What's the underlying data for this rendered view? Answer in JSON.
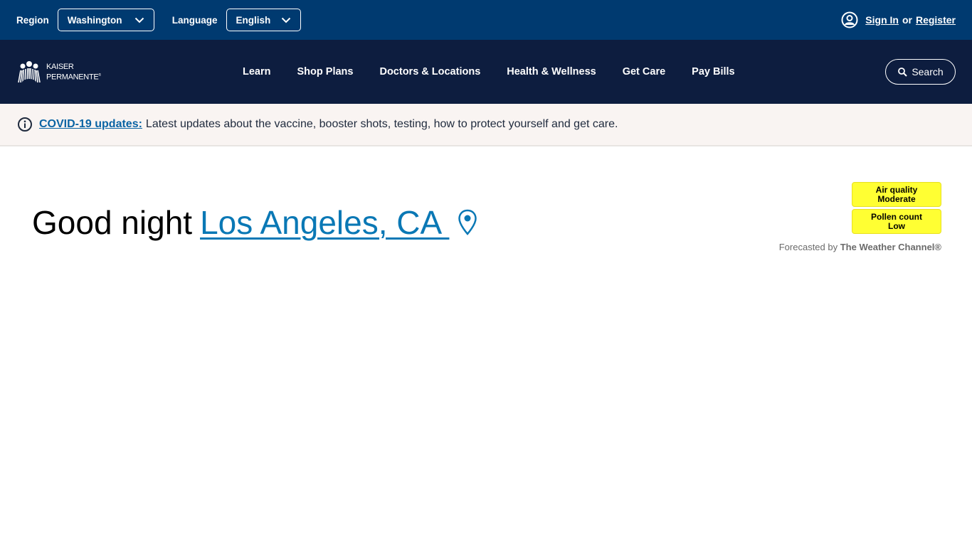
{
  "utility": {
    "region_label": "Region",
    "region_value": "Washington",
    "language_label": "Language",
    "language_value": "English",
    "sign_in": "Sign In",
    "or": "or",
    "register": "Register"
  },
  "nav": {
    "logo_line1": "KAISER",
    "logo_line2": "PERMANENTE",
    "links": [
      "Learn",
      "Shop Plans",
      "Doctors & Locations",
      "Health & Wellness",
      "Get Care",
      "Pay Bills"
    ],
    "search_label": "Search"
  },
  "alert": {
    "link_text": "COVID-19 updates:",
    "message": "Latest updates about the vaccine, booster shots, testing, how to protect yourself and get care."
  },
  "greeting": {
    "salutation": "Good night",
    "location": "Los Angeles, CA "
  },
  "weather": {
    "air_quality_label": "Air quality",
    "air_quality_value": "Moderate",
    "pollen_label": "Pollen count",
    "pollen_value": "Low",
    "forecast_prefix": "Forecasted by",
    "forecast_source": "The Weather Channel®"
  },
  "colors": {
    "utility_bg": "#003a70",
    "nav_bg": "#0d1d3f",
    "alert_bg": "#f9f4f2",
    "link_blue": "#0a78b5",
    "badge_yellow": "#ffff33"
  }
}
